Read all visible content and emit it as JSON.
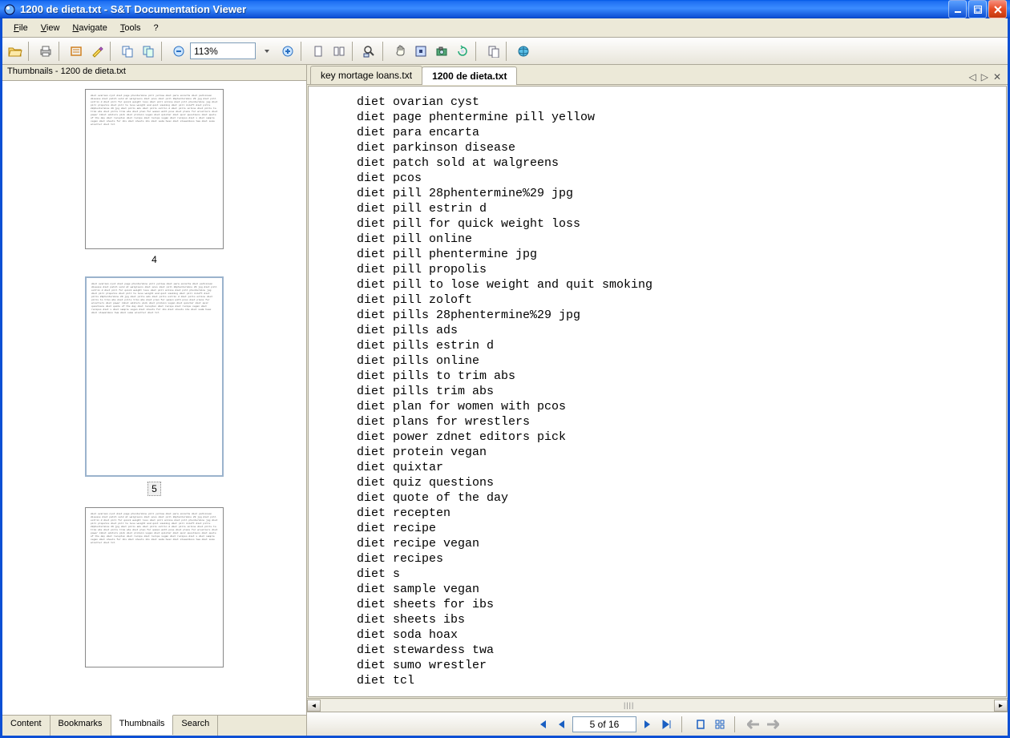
{
  "window": {
    "title": "1200 de dieta.txt - S&T Documentation Viewer"
  },
  "menu": {
    "file": "File",
    "view": "View",
    "navigate": "Navigate",
    "tools": "Tools",
    "help": "?"
  },
  "toolbar": {
    "zoom": "113%"
  },
  "sidebar": {
    "title": "Thumbnails - 1200 de dieta.txt",
    "page4": "4",
    "page5": "5",
    "tabs": {
      "content": "Content",
      "bookmarks": "Bookmarks",
      "thumbnails": "Thumbnails",
      "search": "Search"
    }
  },
  "tabs": {
    "tab1": "key mortage loans.txt",
    "tab2": "1200 de dieta.txt"
  },
  "thumb_lines": "diet ovarian cyst\ndiet page phentermine pill yellow\ndiet para encarta\ndiet parkinson disease\ndiet patch sold at walgreens\ndiet pcos\ndiet pill 28phentermine 29 jpg\ndiet pill estrin d\ndiet pill for quick weight loss\ndiet pill online\ndiet pill phentermine jpg\ndiet pill propolis\ndiet pill to lose weight and quit smoking\ndiet pill zoloft\ndiet pills 28phentermine 29 jpg\ndiet pills ads\ndiet pills estrin d\ndiet pills online\ndiet pills to trim abs\ndiet pills trim abs\ndiet plan for women with pcos\ndiet plans for wrestlers\ndiet power zdnet editors pick\ndiet protein vegan\ndiet quixtar\ndiet quiz questions\ndiet quote of the day\ndiet recepten\ndiet recipe\ndiet recipe vegan\ndiet recipes\ndiet s\ndiet sample vegan\ndiet sheets for ibs\ndiet sheets ibs\ndiet soda hoax\ndiet stewardess twa\ndiet sumo wrestler\ndiet tcl",
  "document": {
    "lines": [
      "diet ovarian cyst",
      "diet page phentermine pill yellow",
      "diet para encarta",
      "diet parkinson disease",
      "diet patch sold at walgreens",
      "diet pcos",
      "diet pill 28phentermine%29 jpg",
      "diet pill estrin d",
      "diet pill for quick weight loss",
      "diet pill online",
      "diet pill phentermine jpg",
      "diet pill propolis",
      "diet pill to lose weight and quit smoking",
      "diet pill zoloft",
      "diet pills 28phentermine%29 jpg",
      "diet pills ads",
      "diet pills estrin d",
      "diet pills online",
      "diet pills to trim abs",
      "diet pills trim abs",
      "diet plan for women with pcos",
      "diet plans for wrestlers",
      "diet power zdnet editors pick",
      "diet protein vegan",
      "diet quixtar",
      "diet quiz questions",
      "diet quote of the day",
      "diet recepten",
      "diet recipe",
      "diet recipe vegan",
      "diet recipes",
      "diet s",
      "diet sample vegan",
      "diet sheets for ibs",
      "diet sheets ibs",
      "diet soda hoax",
      "diet stewardess twa",
      "diet sumo wrestler",
      "diet tcl"
    ]
  },
  "pagenav": {
    "status": "5 of 16"
  }
}
